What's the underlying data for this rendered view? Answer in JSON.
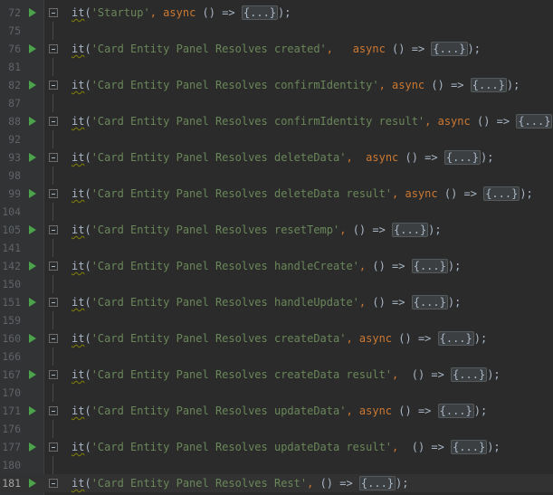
{
  "editor": {
    "lines": [
      {
        "num": "72",
        "run": true,
        "fold_icon": true,
        "fn": "it",
        "str": "'Startup'",
        "sep": ", ",
        "async": "async ",
        "arrow": "() => ",
        "folded": "{...}",
        "end": ");",
        "current": false
      },
      {
        "num": "75",
        "run": false,
        "fold_icon": false,
        "guide": true
      },
      {
        "num": "76",
        "run": true,
        "fold_icon": true,
        "fn": "it",
        "str": "'Card Entity Panel Resolves created'",
        "sep": ",   ",
        "async": "async ",
        "arrow": "() => ",
        "folded": "{...}",
        "end": ");",
        "current": false
      },
      {
        "num": "81",
        "run": false,
        "fold_icon": false,
        "guide": true
      },
      {
        "num": "82",
        "run": true,
        "fold_icon": true,
        "fn": "it",
        "str": "'Card Entity Panel Resolves confirmIdentity'",
        "sep": ", ",
        "async": "async ",
        "arrow": "() => ",
        "folded": "{...}",
        "end": ");",
        "current": false
      },
      {
        "num": "87",
        "run": false,
        "fold_icon": false,
        "guide": true
      },
      {
        "num": "88",
        "run": true,
        "fold_icon": true,
        "fn": "it",
        "str": "'Card Entity Panel Resolves confirmIdentity result'",
        "sep": ", ",
        "async": "async ",
        "arrow": "() => ",
        "folded": "{...}",
        "end": ");",
        "current": false
      },
      {
        "num": "92",
        "run": false,
        "fold_icon": false,
        "guide": true
      },
      {
        "num": "93",
        "run": true,
        "fold_icon": true,
        "fn": "it",
        "str": "'Card Entity Panel Resolves deleteData'",
        "sep": ",  ",
        "async": "async ",
        "arrow": "() => ",
        "folded": "{...}",
        "end": ");",
        "current": false
      },
      {
        "num": "98",
        "run": false,
        "fold_icon": false,
        "guide": true
      },
      {
        "num": "99",
        "run": true,
        "fold_icon": true,
        "fn": "it",
        "str": "'Card Entity Panel Resolves deleteData result'",
        "sep": ", ",
        "async": "async ",
        "arrow": "() => ",
        "folded": "{...}",
        "end": ");",
        "current": false
      },
      {
        "num": "104",
        "run": false,
        "fold_icon": false,
        "guide": true
      },
      {
        "num": "105",
        "run": true,
        "fold_icon": true,
        "fn": "it",
        "str": "'Card Entity Panel Resolves resetTemp'",
        "sep": ", ",
        "async": "",
        "arrow": "() => ",
        "folded": "{...}",
        "end": ");",
        "current": false
      },
      {
        "num": "141",
        "run": false,
        "fold_icon": false,
        "guide": true
      },
      {
        "num": "142",
        "run": true,
        "fold_icon": true,
        "fn": "it",
        "str": "'Card Entity Panel Resolves handleCreate'",
        "sep": ", ",
        "async": "",
        "arrow": "() => ",
        "folded": "{...}",
        "end": ");",
        "current": false
      },
      {
        "num": "150",
        "run": false,
        "fold_icon": false,
        "guide": true
      },
      {
        "num": "151",
        "run": true,
        "fold_icon": true,
        "fn": "it",
        "str": "'Card Entity Panel Resolves handleUpdate'",
        "sep": ", ",
        "async": "",
        "arrow": "() => ",
        "folded": "{...}",
        "end": ");",
        "current": false
      },
      {
        "num": "159",
        "run": false,
        "fold_icon": false,
        "guide": true
      },
      {
        "num": "160",
        "run": true,
        "fold_icon": true,
        "fn": "it",
        "str": "'Card Entity Panel Resolves createData'",
        "sep": ", ",
        "async": "async ",
        "arrow": "() => ",
        "folded": "{...}",
        "end": ");",
        "current": false
      },
      {
        "num": "166",
        "run": false,
        "fold_icon": false,
        "guide": true
      },
      {
        "num": "167",
        "run": true,
        "fold_icon": true,
        "fn": "it",
        "str": "'Card Entity Panel Resolves createData result'",
        "sep": ",  ",
        "async": "",
        "arrow": "() => ",
        "folded": "{...}",
        "end": ");",
        "current": false
      },
      {
        "num": "170",
        "run": false,
        "fold_icon": false,
        "guide": true
      },
      {
        "num": "171",
        "run": true,
        "fold_icon": true,
        "fn": "it",
        "str": "'Card Entity Panel Resolves updateData'",
        "sep": ", ",
        "async": "async ",
        "arrow": "() => ",
        "folded": "{...}",
        "end": ");",
        "current": false
      },
      {
        "num": "176",
        "run": false,
        "fold_icon": false,
        "guide": true
      },
      {
        "num": "177",
        "run": true,
        "fold_icon": true,
        "fn": "it",
        "str": "'Card Entity Panel Resolves updateData result'",
        "sep": ",  ",
        "async": "",
        "arrow": "() => ",
        "folded": "{...}",
        "end": ");",
        "current": false
      },
      {
        "num": "180",
        "run": false,
        "fold_icon": false,
        "guide": true
      },
      {
        "num": "181",
        "run": true,
        "fold_icon": true,
        "fn": "it",
        "str": "'Card Entity Panel Resolves Rest'",
        "sep": ", ",
        "async": "",
        "arrow": "() => ",
        "folded": "{...}",
        "end": ");",
        "current": true
      }
    ]
  }
}
